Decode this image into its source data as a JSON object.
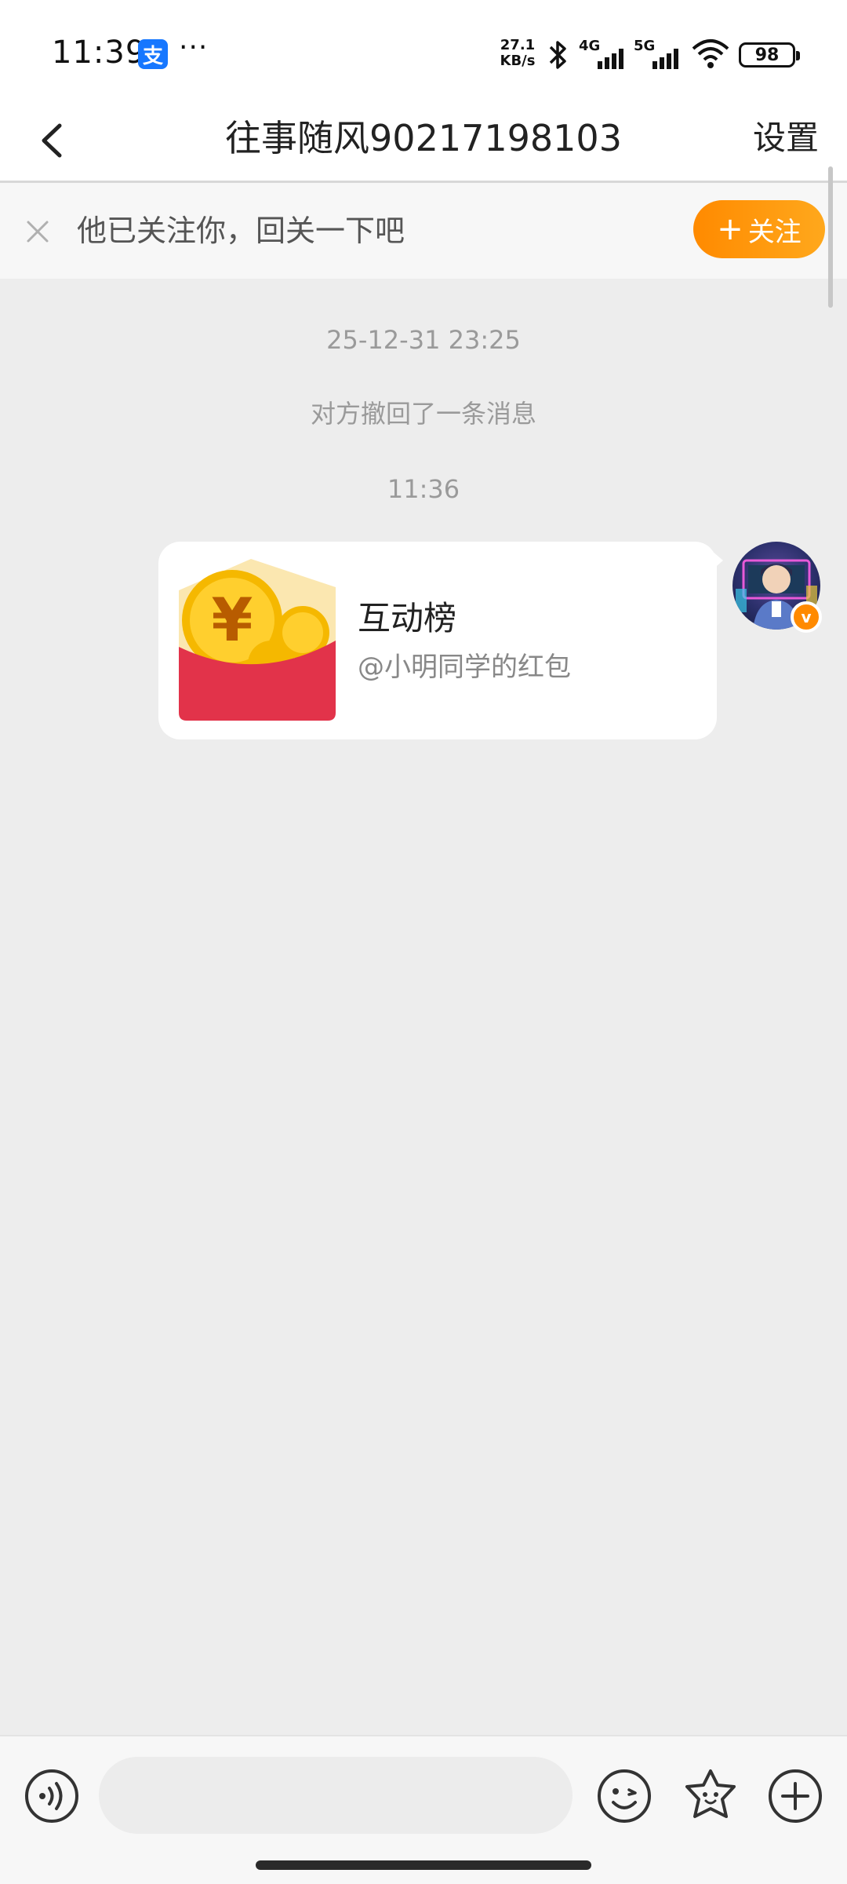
{
  "status_bar": {
    "time": "11:39",
    "alipay_glyph": "支",
    "more": "···",
    "net_speed_value": "27.1",
    "net_speed_unit": "KB/s",
    "signal_1_label": "4G",
    "signal_2_label": "5G",
    "battery": "98"
  },
  "header": {
    "back_icon": "chevron-left-icon",
    "title": "往事随风90217198103",
    "settings_label": "设置"
  },
  "follow_banner": {
    "text": "他已关注你，回关一下吧",
    "button_plus": "+",
    "button_label": "关注",
    "accent": "#ff8a00"
  },
  "chat": {
    "timestamp_1": "25-12-31 23:25",
    "recall_notice": "对方撤回了一条消息",
    "timestamp_2": "11:36",
    "message": {
      "icon": "red-envelope-icon",
      "title": "互动榜",
      "subtitle": "@小明同学的红包",
      "verified_badge": "v"
    }
  },
  "input_bar": {
    "placeholder": "",
    "voice_icon": "voice-icon",
    "emoji_icon": "emoji-icon",
    "sticker_icon": "sticker-icon",
    "plus_icon": "plus-circle-icon"
  },
  "colors": {
    "background": "#ededed",
    "bubble": "#ffffff",
    "envelope_red": "#e2334a",
    "coin_gold": "#f5b800"
  }
}
